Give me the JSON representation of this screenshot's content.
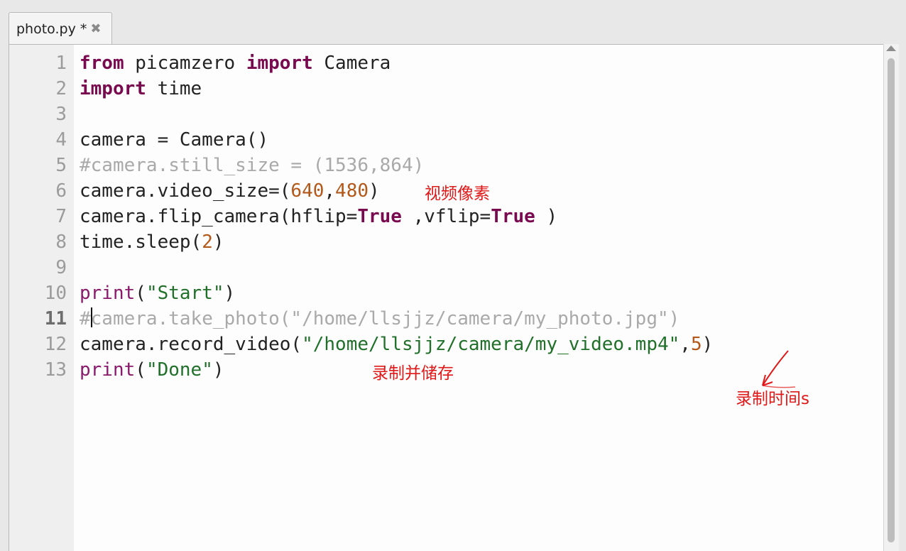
{
  "tab": {
    "label": "photo.py *",
    "close_icon": "close-icon"
  },
  "editor": {
    "current_line": 11,
    "line_numbers": [
      "1",
      "2",
      "3",
      "4",
      "5",
      "6",
      "7",
      "8",
      "9",
      "10",
      "11",
      "12",
      "13"
    ],
    "lines": [
      "from picamzero import Camera",
      "import time",
      "",
      "camera = Camera()",
      "#camera.still_size = (1536,864)",
      "camera.video_size=(640,480)",
      "camera.flip_camera(hflip=True ,vflip=True )",
      "time.sleep(2)",
      "",
      "print(\"Start\")",
      "#camera.take_photo(\"/home/llsjjz/camera/my_photo.jpg\")",
      "camera.record_video(\"/home/llsjjz/camera/my_video.mp4\",5)",
      "print(\"Done\")"
    ]
  },
  "annotations": {
    "video_size_note": "视频像素",
    "record_save_note": "录制并储存",
    "record_time_note": "录制时间s"
  },
  "colors": {
    "keyword": "#7a0a4f",
    "number": "#b4581a",
    "string": "#21702a",
    "comment": "#a9a9a9",
    "annotation": "#e01818"
  }
}
